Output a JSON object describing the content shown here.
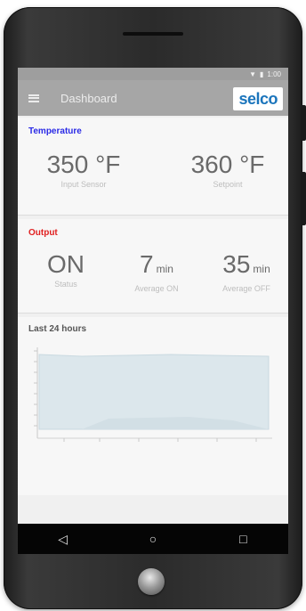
{
  "app": {
    "title": "Dashboard",
    "logo": "selco",
    "status_time": "1:00"
  },
  "temperature": {
    "title": "Temperature",
    "input_sensor": {
      "value": "350 °F",
      "label": "Input Sensor"
    },
    "setpoint": {
      "value": "360 °F",
      "label": "Setpoint"
    }
  },
  "output": {
    "title": "Output",
    "status": {
      "value": "ON",
      "label": "Status"
    },
    "average_on": {
      "value": "7",
      "unit": "min",
      "label": "Average ON"
    },
    "average_off": {
      "value": "35",
      "unit": "min",
      "label": "Average OFF"
    }
  },
  "history": {
    "title": "Last 24 hours"
  },
  "nav": {
    "back": "◁",
    "home": "○",
    "recents": "□"
  },
  "colors": {
    "temperature_title": "#2a2ae6",
    "output_title": "#e02020",
    "logo": "#1b75bc",
    "chart_fill": "#dce7ec"
  }
}
